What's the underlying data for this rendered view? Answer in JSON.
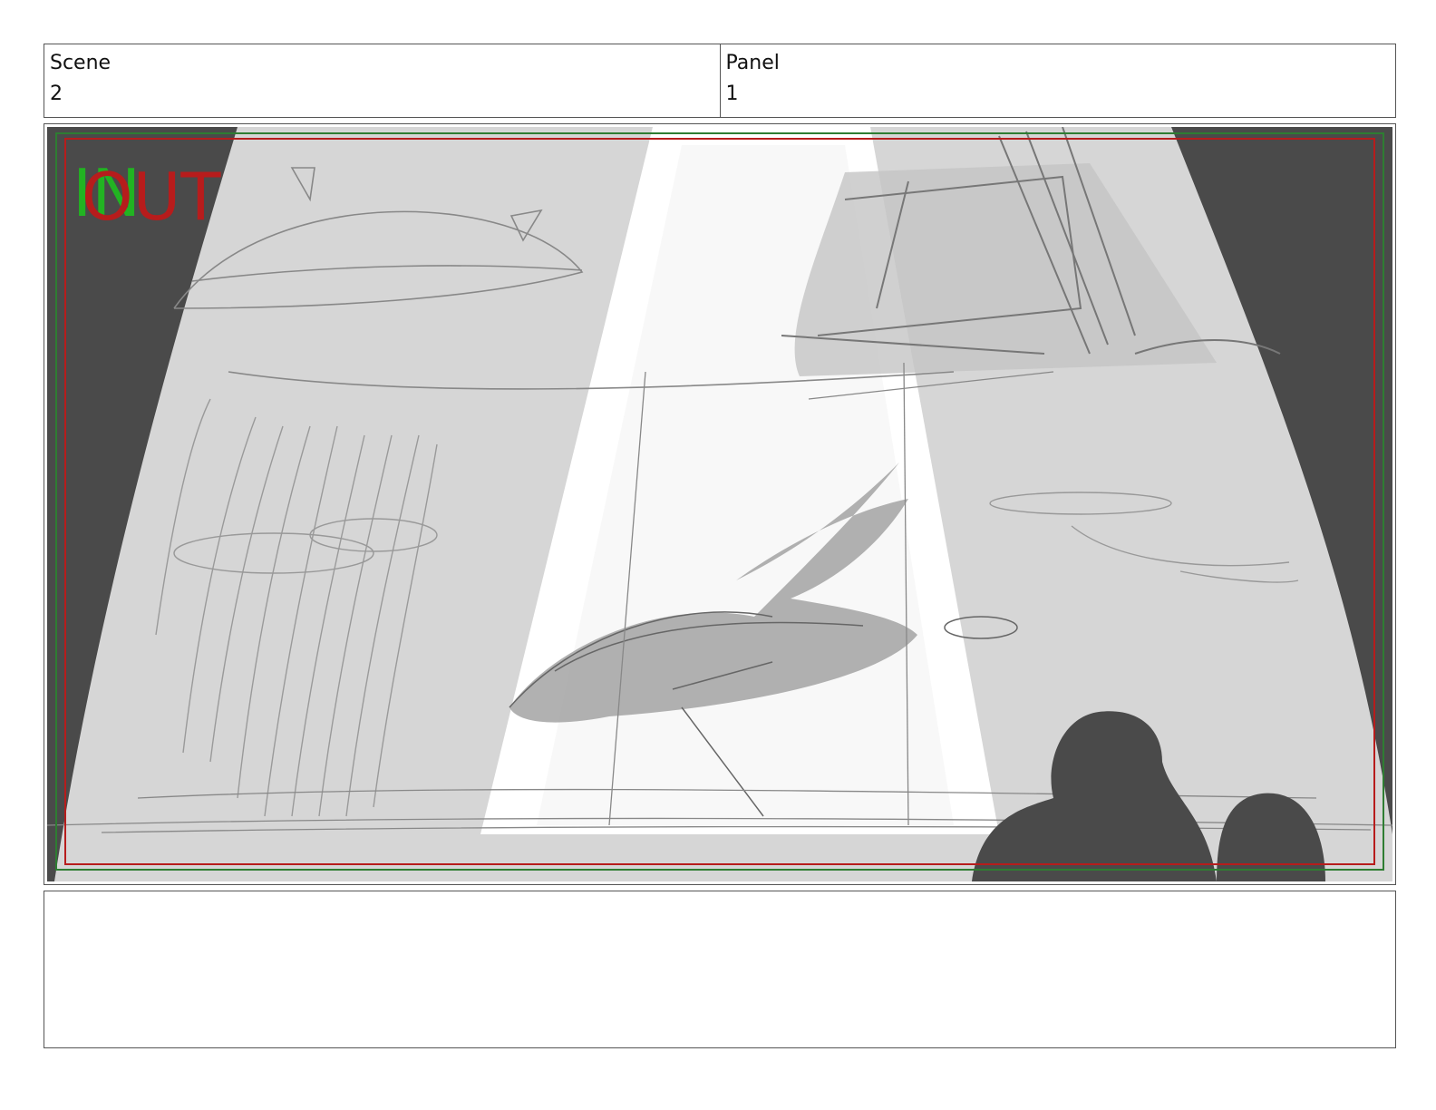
{
  "header": {
    "scene_label": "Scene",
    "scene_value": "2",
    "panel_label": "Panel",
    "panel_value": "1"
  },
  "panel": {
    "in_marker": "IN",
    "out_marker": "OUT",
    "colors": {
      "safe_area_green": "#2e7d32",
      "safe_area_red": "#b71c1c",
      "sky_gray": "#d6d6d6",
      "curtain_dark": "#4a4a4a",
      "beam_white": "#ffffff"
    }
  },
  "notes": {
    "text": ""
  }
}
